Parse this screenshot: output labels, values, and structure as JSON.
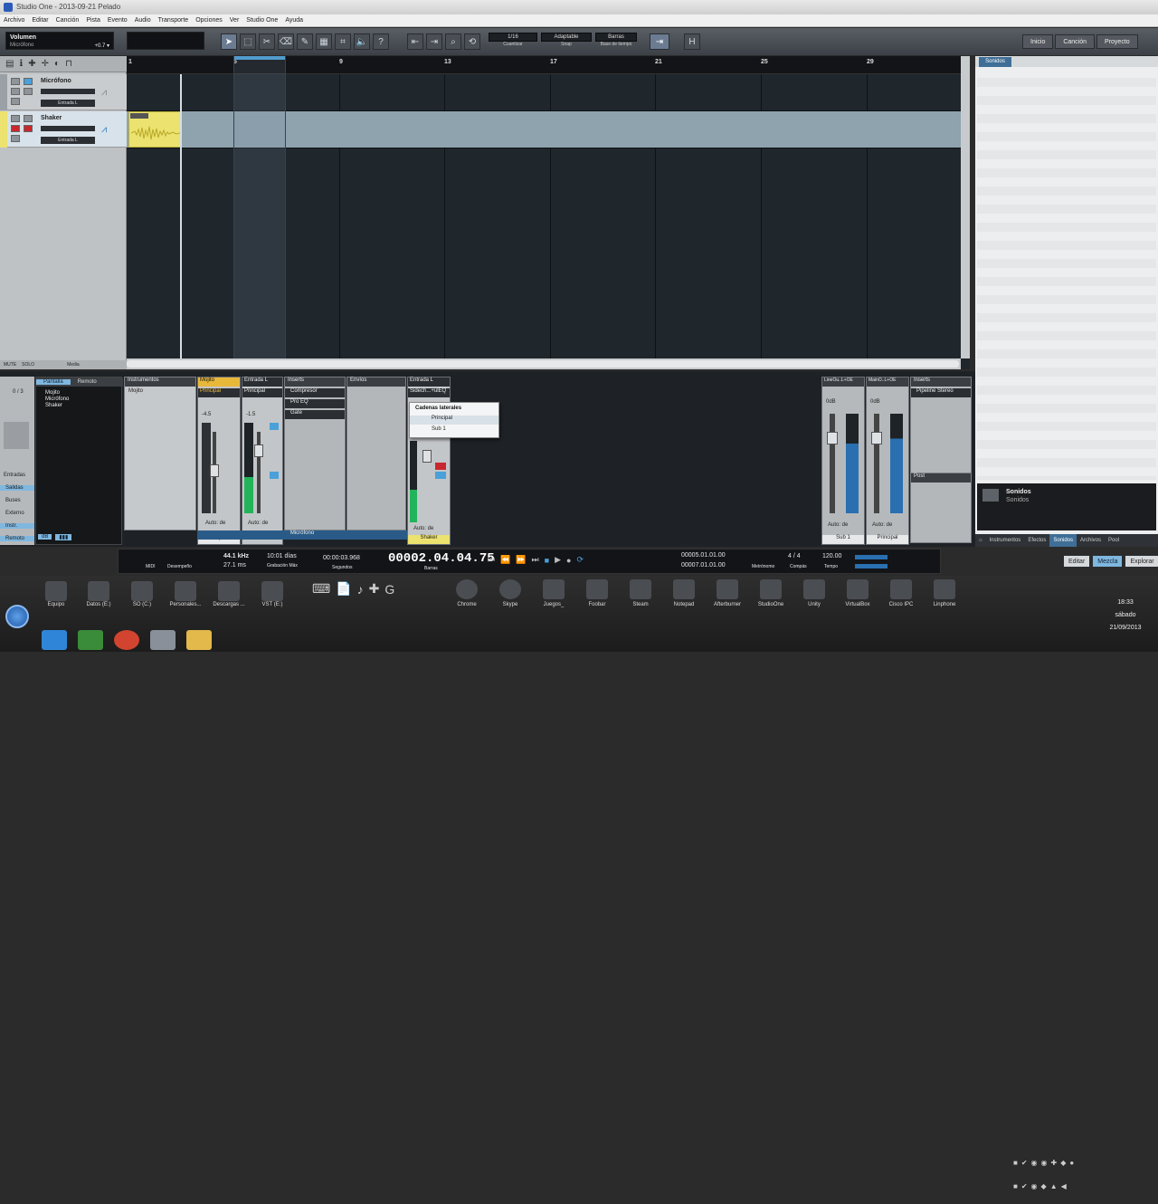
{
  "window": {
    "title": "Studio One - 2013-09-21 Pelado"
  },
  "menu": [
    "Archivo",
    "Editar",
    "Canción",
    "Pista",
    "Evento",
    "Audio",
    "Transporte",
    "Opciones",
    "Ver",
    "Studio One",
    "Ayuda"
  ],
  "toolbar": {
    "volume_label": "Volumen",
    "volume_track": "Micrófono",
    "volume_value": "+0.7 ▾",
    "quantize_value": "1/16",
    "quantize_label": "Cuantizar",
    "snap_value": "Adaptable",
    "snap_label": "Snap",
    "timebase_value": "Barras",
    "timebase_label": "Base de tiempo",
    "nav": [
      "Inicio",
      "Canción",
      "Proyecto"
    ]
  },
  "tracks": [
    {
      "name": "Micrófono",
      "input": "Entrada L"
    },
    {
      "name": "Shaker",
      "input": "Entrada L"
    }
  ],
  "tracklist_footer": {
    "mute": "MUTE",
    "solo": "SOLO",
    "media": "Media"
  },
  "ruler": {
    "bars": [
      "1",
      "5",
      "9",
      "13",
      "17",
      "21",
      "25",
      "29"
    ]
  },
  "browser": {
    "tab": "Sonidos",
    "info_title": "Sonidos",
    "info_sub": "Sonidos",
    "bottom_tabs": [
      "Instrumentos",
      "Efectos",
      "Sonidos",
      "Archivos",
      "Pool"
    ]
  },
  "console": {
    "io_tabs": [
      "Pantalla",
      "Remoto"
    ],
    "tree": [
      "Mojito",
      "Micrófono",
      "Shaker"
    ],
    "side_labels": [
      "Entradas",
      "Salidas",
      "Buses",
      "Externo",
      "Instr.",
      "Remoto"
    ],
    "counter": "0 / 3",
    "db_label": "dB",
    "instruments_header": "Instrumentos",
    "instruments_item": "Mojito",
    "ch1": {
      "header": "Mojito",
      "route": "Principal",
      "value": "-4.5",
      "auto": "Auto: de",
      "name": "Mojito"
    },
    "ch2": {
      "header": "Entrada L",
      "route": "Principal",
      "value": "-1.5",
      "auto": "Auto: de",
      "name": "Micrófono"
    },
    "inserts_header": "Inserts",
    "inserts": [
      "Compresor",
      "Pro EQ",
      "Gate"
    ],
    "envios_header": "Envíos",
    "ch3": {
      "header": "Entrada L",
      "sub": "Sidech...+ulEQ",
      "auto": "Auto: de",
      "name": "Shaker"
    },
    "popup": {
      "title": "Cadenas laterales",
      "items": [
        "Principal",
        "Sub 1"
      ]
    },
    "out1": {
      "header": "LineOu..L+OE",
      "value": "0dB",
      "auto": "Auto: de",
      "name": "Sub 1"
    },
    "out2": {
      "header": "MainO..L+OE",
      "value": "0dB",
      "auto": "Auto: de",
      "name": "Principal"
    },
    "out_inserts_header": "Inserts",
    "out_insert": "Pipeline Stereo",
    "post_header": "Post"
  },
  "transport": {
    "midi": "MIDI",
    "performance": "Desempeño",
    "samplerate": "44.1 kHz",
    "latency": "27.1 ms",
    "recordtime": "10:01 días",
    "recordtime_label": "Grabación Máx",
    "seconds": "00:00:03.968",
    "seconds_label": "Segundos",
    "position": "00002.04.04.75",
    "position_label": "Barras",
    "loop_start": "00005.01.01.00",
    "loop_end": "00007.01.01.00",
    "metronome_label": "Metrónomo",
    "signature": "4 / 4",
    "signature_label": "Compás",
    "tempo": "120.00",
    "tempo_label": "Tempo"
  },
  "right_buttons": [
    "Editar",
    "Mezcla",
    "Explorar"
  ],
  "taskbar": {
    "row1": [
      "Equipo",
      "Datos (E:)",
      "SO (C:)",
      "Personales...",
      "Descargas ...",
      "VST (E:)"
    ],
    "row2": [
      "Chrome",
      "Skype",
      "Juegos_",
      "Foobar",
      "Steam",
      "Notepad",
      "Afterburner",
      "StudioOne",
      "Unity",
      "VirtualBox",
      "Cisco IPC",
      "Linphone"
    ],
    "time": "18:33",
    "day": "sábado",
    "date": "21/09/2013"
  },
  "colors": {
    "accent": "#3f6e96",
    "clip": "#ece26f",
    "track_selected": "#8fa3ae",
    "record": "#c8282d"
  }
}
